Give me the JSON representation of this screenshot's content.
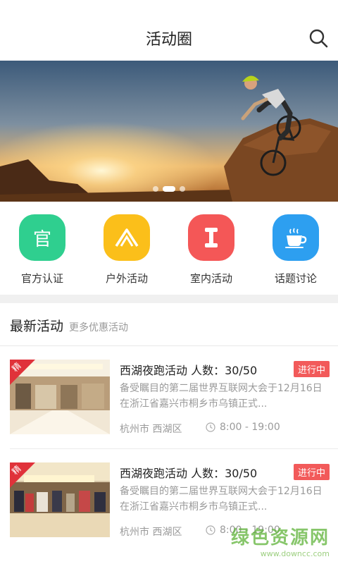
{
  "header": {
    "title": "活动圈",
    "search_icon": "search-icon"
  },
  "banner": {
    "slide_count": 3,
    "active_slide": 2
  },
  "categories": [
    {
      "label": "官方认证",
      "icon": "official-badge-icon",
      "glyph": "官",
      "color": "#2fcf8f"
    },
    {
      "label": "户外活动",
      "icon": "tent-icon",
      "color": "#fbbf1a"
    },
    {
      "label": "室内活动",
      "icon": "dumbbell-icon",
      "color": "#f45757"
    },
    {
      "label": "话题讨论",
      "icon": "coffee-cup-icon",
      "color": "#2d9ff0"
    }
  ],
  "section": {
    "title": "最新活动",
    "subtitle": "更多优惠活动"
  },
  "activities": [
    {
      "ribbon": "精",
      "title": "西湖夜跑活动  人数：30/50",
      "status": "进行中",
      "desc": "备受瞩目的第二届世界互联网大会于12月16日在浙江省嘉兴市桐乡市乌镇正式...",
      "location": "杭州市  西湖区",
      "time": "8:00 - 19:00"
    },
    {
      "ribbon": "精",
      "title": "西湖夜跑活动  人数：30/50",
      "status": "进行中",
      "desc": "备受瞩目的第二届世界互联网大会于12月16日在浙江省嘉兴市桐乡市乌镇正式...",
      "location": "杭州市  西湖区",
      "time": "8:00 - 19:00"
    }
  ],
  "watermark": {
    "text": "绿色资源网",
    "url": "www.downcc.com"
  },
  "colors": {
    "status_badge": "#f25a5a",
    "ribbon": "#e0323a",
    "divider": "#f0f0f0"
  }
}
